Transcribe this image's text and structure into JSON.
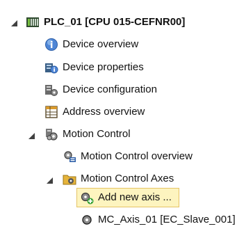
{
  "tree": {
    "plc": {
      "label": "PLC_01 [CPU 015-CEFNR00]",
      "expanded": true
    },
    "device_overview": {
      "label": "Device overview"
    },
    "device_properties": {
      "label": "Device properties"
    },
    "device_configuration": {
      "label": "Device configuration"
    },
    "address_overview": {
      "label": "Address overview"
    },
    "motion_control": {
      "label": "Motion Control",
      "expanded": true
    },
    "motion_control_overview": {
      "label": "Motion Control overview"
    },
    "motion_control_axes": {
      "label": "Motion Control Axes",
      "expanded": true
    },
    "add_new_axis": {
      "label": "Add new axis ...",
      "selected": true
    },
    "mc_axis_01": {
      "label": "MC_Axis_01 [EC_Slave_001]"
    }
  },
  "colors": {
    "selection_background": "#fdf4bf",
    "selection_border": "#e5c365",
    "text": "#111111"
  },
  "icons": {
    "plc": "plc-device-icon",
    "device_overview": "info-globe-icon",
    "device_properties": "properties-icon",
    "device_configuration": "configuration-icon",
    "address_overview": "address-table-icon",
    "motion_control": "motion-gears-icon",
    "motion_control_overview": "motion-overview-icon",
    "motion_control_axes": "axes-folder-icon",
    "add_new_axis": "add-axis-icon",
    "mc_axis_01": "axis-icon"
  }
}
